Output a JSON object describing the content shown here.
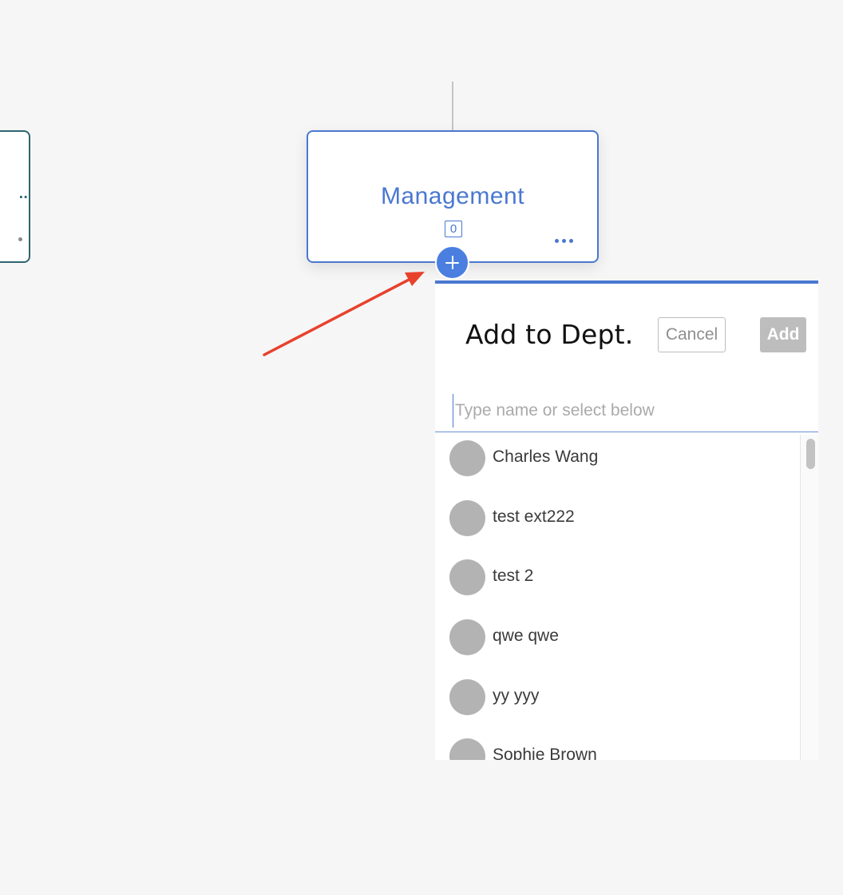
{
  "org_chart": {
    "main_dept": {
      "title": "Management",
      "member_count": "0"
    },
    "left_card": {
      "truncated_text": ".."
    }
  },
  "add_panel": {
    "title": "Add to Dept.",
    "cancel_label": "Cancel",
    "add_label": "Add",
    "search_placeholder": "Type name or select below",
    "people": [
      {
        "name": "Charles Wang"
      },
      {
        "name": "test ext222"
      },
      {
        "name": "test 2"
      },
      {
        "name": "qwe qwe"
      },
      {
        "name": "yy yyy"
      },
      {
        "name": "Sophie Brown"
      }
    ]
  },
  "colors": {
    "accent": "#4a78d0",
    "add_circle": "#4a7fe0",
    "annotation_arrow": "#e8412c",
    "left_card_border": "#2f6472",
    "avatar_placeholder": "#b3b3b3",
    "background": "#f6f6f6"
  }
}
